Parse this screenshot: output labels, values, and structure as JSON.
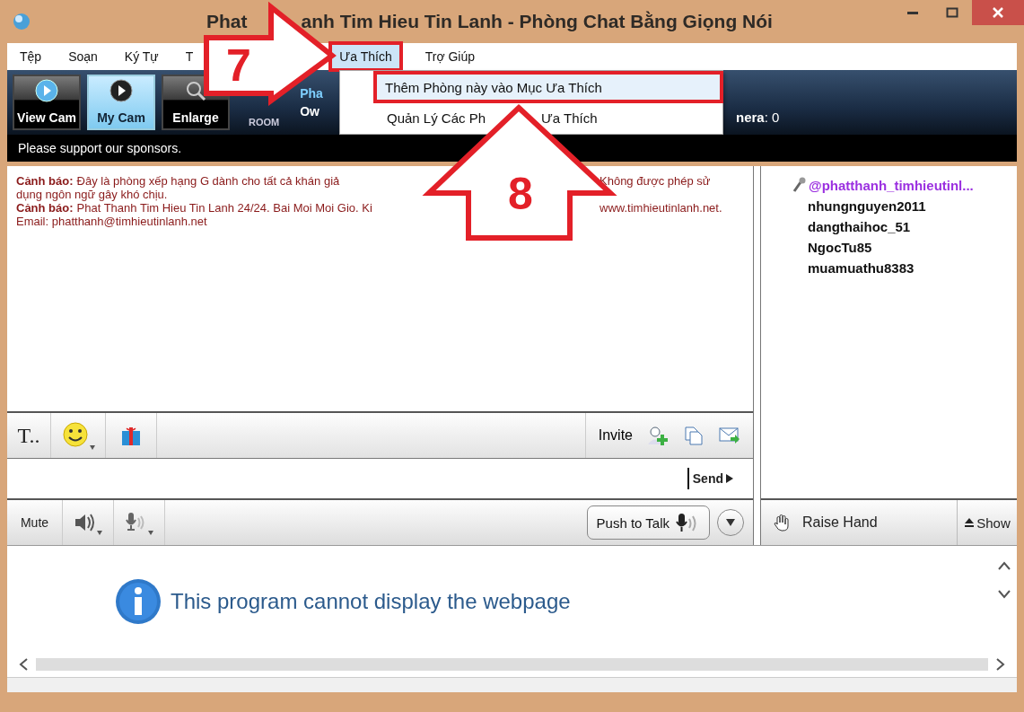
{
  "window": {
    "title_parts": [
      "Phat",
      "anh Tim Hieu Tin Lanh - Phòng Chat Bằng Giọng Nói"
    ]
  },
  "menu": [
    {
      "label": "Tệp",
      "selected": false
    },
    {
      "label": "Soạn",
      "selected": false
    },
    {
      "label": "Ký Tự",
      "selected": false
    },
    {
      "label": "T",
      "selected": false
    },
    {
      "label": "Ưa Thích",
      "selected": true
    },
    {
      "label": "Trợ Giúp",
      "selected": false
    }
  ],
  "dropdown": [
    {
      "label_parts": [
        "Thêm Phòng này vào Mục Ưa Thích"
      ],
      "selected": true
    },
    {
      "label_parts": [
        "Quản Lý Các Ph",
        "Ưa Thích"
      ],
      "selected": false
    }
  ],
  "toolbar": [
    {
      "label": "View Cam",
      "kind": "view",
      "selected": false
    },
    {
      "label": "My Cam",
      "kind": "mycam",
      "selected": true
    },
    {
      "label": "Enlarge",
      "kind": "enlarge",
      "selected": false
    },
    {
      "label": "ROOM",
      "kind": "room",
      "selected": false
    }
  ],
  "room_info": {
    "line_1": "Pha",
    "line_2": "Ow",
    "camera_text": "**nera**: 0"
  },
  "sponsor_text": "Please support our sponsors.",
  "chat_messages": [
    {
      "label": "Cảnh báo:",
      "lines": [
        [
          "Đây là phòng xếp hạng G dành cho tất cả khán giả",
          "Không được phép sử"
        ],
        [
          "dụng ngôn ngữ gây khó chịu."
        ]
      ]
    },
    {
      "label": "Cảnh báo:",
      "lines": [
        [
          "Phat Thanh Tim Hieu Tin Lanh 24/24. Bai Moi Moi Gio. Ki",
          "www.timhieutinlanh.net."
        ],
        [
          "Email: phatthanh@timhieutinlanh.net"
        ]
      ]
    }
  ],
  "users": [
    {
      "name": "@phatthanh_timhieutinl...",
      "kind": "host"
    },
    {
      "name": "nhungnguyen2011",
      "kind": "user"
    },
    {
      "name": "dangthaihoc_51",
      "kind": "user"
    },
    {
      "name": "NgocTu85",
      "kind": "user"
    },
    {
      "name": "muamuathu8383",
      "kind": "user"
    }
  ],
  "format_bar": {
    "font_button": "T..",
    "invite": "Invite"
  },
  "send_button": "Send",
  "audio_bar": {
    "mute": "Mute",
    "push_to_talk": "Push to Talk"
  },
  "raise_hand": "Raise Hand",
  "show_button": "Show",
  "web_message": "This program cannot display the webpage",
  "annotations": [
    {
      "kind": "arrow-right",
      "label": "7"
    },
    {
      "kind": "arrow-up",
      "label": "8"
    }
  ]
}
